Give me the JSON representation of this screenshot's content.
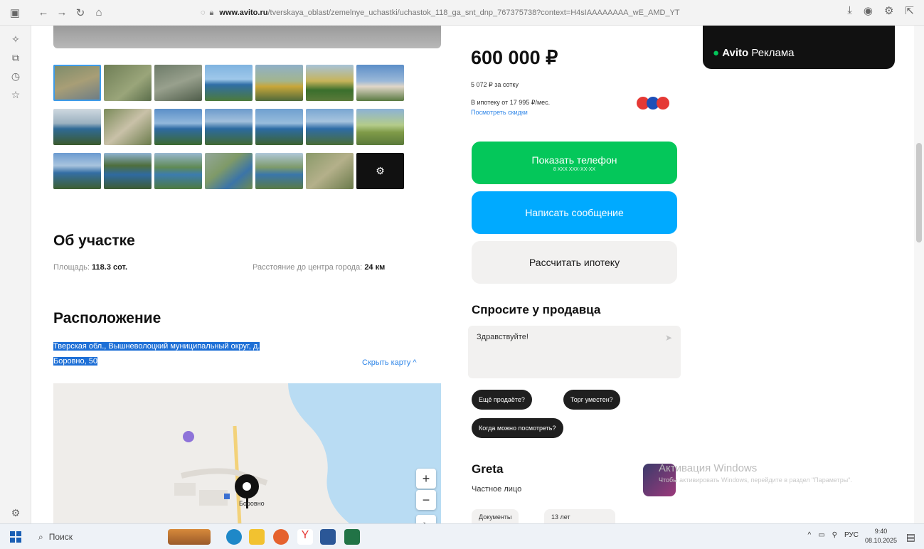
{
  "browser": {
    "url_domain": "www.avito.ru",
    "url_path": "/tverskaya_oblast/zemelnye_uchastki/uchastok_118_ga_snt_dnp_767375738?context=H4sIAAAAAAAA_wE_AMD_YT"
  },
  "gallery": {
    "more_icon": "gear-icon"
  },
  "about": {
    "title": "Об участке",
    "area_label": "Площадь:",
    "area_value": "118.3 сот.",
    "distance_label": "Расстояние до центра города:",
    "distance_value": "24 км"
  },
  "location": {
    "title": "Расположение",
    "address_line1": "Тверская обл., Вышневолоцкий муниципальный округ, д.",
    "address_line2": "Боровно, 50",
    "hide_map": "Скрыть карту ^",
    "map_place": "Боровно",
    "zoom_in": "+",
    "zoom_out": "−"
  },
  "offer": {
    "price": "600 000 ₽",
    "per_sotka": "5 072 ₽ за сотку",
    "mortgage": "В ипотеку от 17 995 ₽/мес.",
    "discounts_link": "Посмотреть скидки",
    "show_phone": "Показать телефон",
    "phone_mask": "8 XXX XXX-XX-XX",
    "write_message": "Написать сообщение",
    "calc_mortgage": "Рассчитать ипотеку"
  },
  "ask": {
    "title": "Спросите у продавца",
    "message": "Здравствуйте!",
    "chips": [
      "Ещё продаёте?",
      "Торг уместен?",
      "Когда можно посмотреть?"
    ]
  },
  "seller": {
    "name": "Greta",
    "type": "Частное лицо",
    "tags": [
      "Документы",
      "13 лет"
    ]
  },
  "ad": {
    "brand": "Avito",
    "text": "Реклама"
  },
  "activation": {
    "title": "Активация Windows",
    "subtitle": "Чтобы активировать Windows, перейдите в раздел \"Параметры\"."
  },
  "taskbar": {
    "search": "Поиск",
    "lang": "РУС",
    "time": "9:40",
    "date": "08.10.2025"
  }
}
